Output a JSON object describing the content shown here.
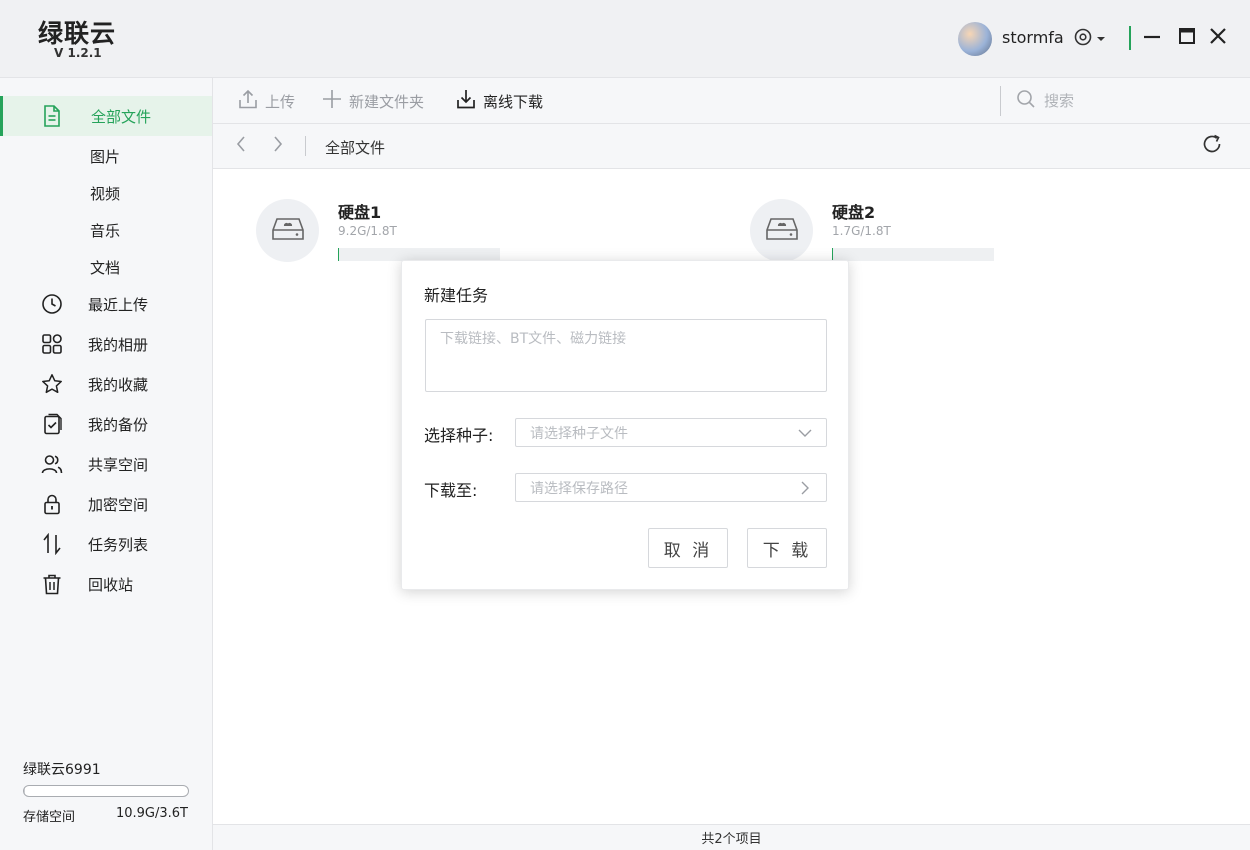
{
  "app": {
    "name": "绿联云",
    "version": "V 1.2.1"
  },
  "user": {
    "name": "stormfa"
  },
  "icons": {
    "settings": "settings-icon",
    "dropdown": "caret-down-icon",
    "minimize": "minimize-icon",
    "maximize": "maximize-icon",
    "close": "close-icon"
  },
  "sidebar": {
    "items": [
      {
        "label": "全部文件",
        "icon": "file-icon",
        "active": true
      },
      {
        "label": "最近上传",
        "icon": "clock-icon"
      },
      {
        "label": "我的相册",
        "icon": "grid-icon"
      },
      {
        "label": "我的收藏",
        "icon": "star-icon"
      },
      {
        "label": "我的备份",
        "icon": "backup-icon"
      },
      {
        "label": "共享空间",
        "icon": "users-icon"
      },
      {
        "label": "加密空间",
        "icon": "lock-icon"
      },
      {
        "label": "任务列表",
        "icon": "transfer-icon"
      },
      {
        "label": "回收站",
        "icon": "trash-icon"
      }
    ],
    "subitems": [
      "图片",
      "视频",
      "音乐",
      "文档"
    ],
    "device_name": "绿联云6991",
    "storage_label": "存储空间",
    "storage_value": "10.9G/3.6T",
    "storage_fraction": 0.003
  },
  "toolbar": {
    "upload": "上传",
    "new_folder": "新建文件夹",
    "offline_download": "离线下载",
    "search_placeholder": "搜索"
  },
  "pathbar": {
    "breadcrumb": "全部文件"
  },
  "disks": [
    {
      "name": "硬盘1",
      "usage": "9.2G/1.8T",
      "fraction": 0.005
    },
    {
      "name": "硬盘2",
      "usage": "1.7G/1.8T",
      "fraction": 0.001
    }
  ],
  "statusbar": {
    "count_text": "共2个项目"
  },
  "dialog": {
    "title": "新建任务",
    "link_placeholder": "下载链接、BT文件、磁力链接",
    "seed_label": "选择种子:",
    "seed_placeholder": "请选择种子文件",
    "path_label": "下载至:",
    "path_placeholder": "请选择保存路径",
    "cancel": "取 消",
    "download": "下 载"
  },
  "colors": {
    "accent": "#25a35a",
    "sidebar_bg": "#f6f7f9",
    "active_bg": "#e6f3ea"
  }
}
